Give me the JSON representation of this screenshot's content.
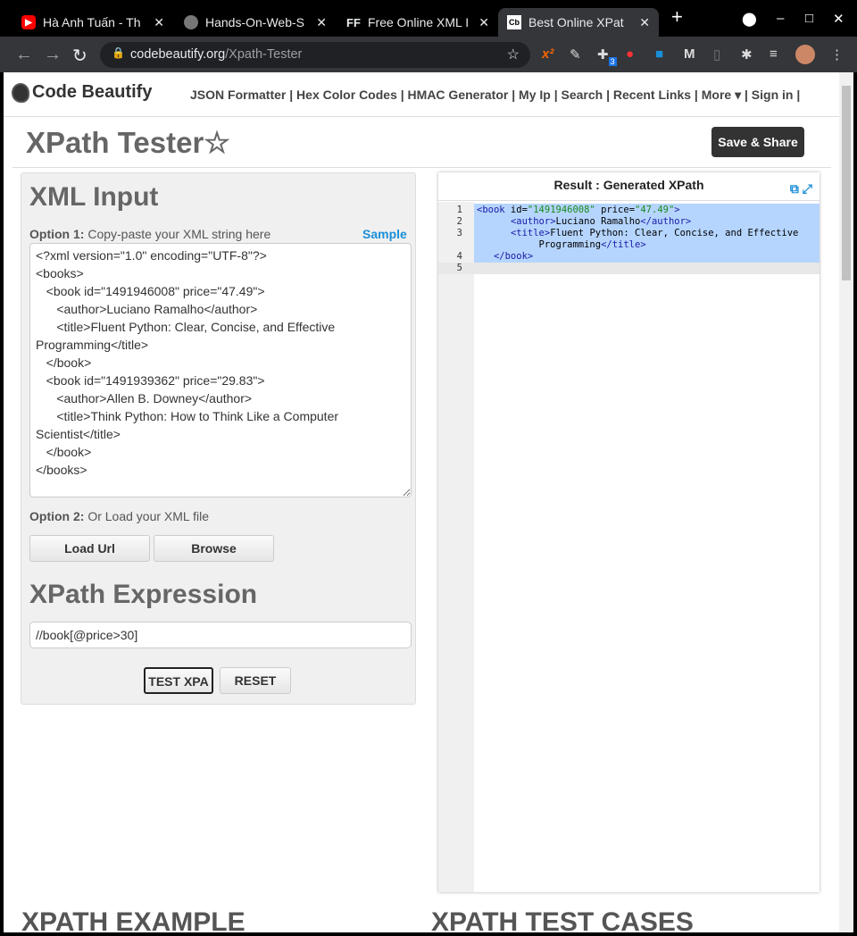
{
  "browser": {
    "tabs": [
      {
        "title": "Hà Anh Tuấn - Th",
        "favicon": "youtube-icon"
      },
      {
        "title": "Hands-On-Web-S",
        "favicon": "github-icon"
      },
      {
        "title": "Free Online XML I",
        "favicon": "FF"
      },
      {
        "title": "Best Online XPat",
        "favicon": "Cb",
        "active": true
      }
    ],
    "url_domain": "codebeautify.org",
    "url_path": "/Xpath-Tester",
    "ext_badge": "3"
  },
  "site": {
    "logo": "Code Beautify",
    "nav": "JSON Formatter | Hex Color Codes | HMAC Generator | My Ip |  Search |  Recent Links |  More ▾ |  Sign in |",
    "page_title": "XPath Tester",
    "save_share": "Save & Share"
  },
  "input": {
    "heading": "XML Input",
    "option1_label": "Option 1:",
    "option1_text": " Copy-paste your XML string here",
    "sample": "Sample",
    "xml": "<?xml version=\"1.0\" encoding=\"UTF-8\"?>\n<books>\n   <book id=\"1491946008\" price=\"47.49\">\n      <author>Luciano Ramalho</author>\n      <title>Fluent Python: Clear, Concise, and Effective Programming</title>\n   </book>\n   <book id=\"1491939362\" price=\"29.83\">\n      <author>Allen B. Downey</author>\n      <title>Think Python: How to Think Like a Computer Scientist</title>\n   </book>\n</books>",
    "option2_label": "Option 2:",
    "option2_text": " Or Load your XML file",
    "load_url": "Load Url",
    "browse": "Browse",
    "xpath_heading": "XPath Expression",
    "xpath_value": "//book[@price>30]",
    "test": "TEST XPA",
    "reset": "RESET"
  },
  "result": {
    "title": "Result : Generated XPath",
    "line_numbers": [
      "1",
      "2",
      "3",
      "4",
      "5"
    ]
  },
  "bottom": {
    "left": "XPATH EXAMPLE",
    "right": "XPATH TEST CASES"
  }
}
